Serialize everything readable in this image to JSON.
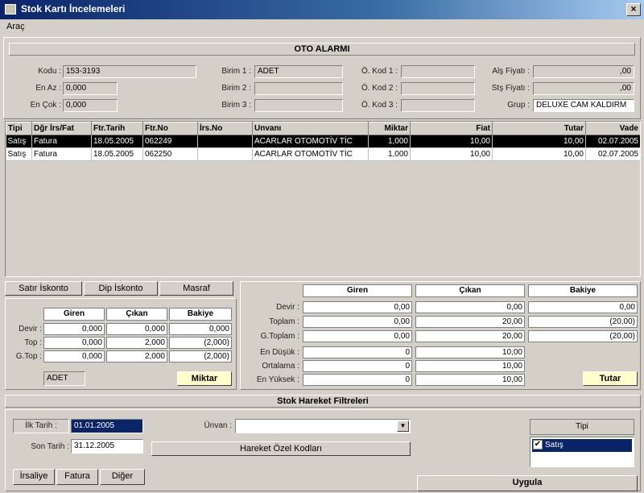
{
  "window": {
    "title": "Stok Kartı İncelemeleri",
    "close": "×"
  },
  "menu": {
    "items": [
      "Araç"
    ]
  },
  "alarm": {
    "title": "OTO ALARMI"
  },
  "info": {
    "kodu_label": "Kodu :",
    "kodu": "153-3193",
    "enaz_label": "En Az :",
    "enaz": "0,000",
    "encok_label": "En Çok :",
    "encok": "0,000",
    "birim1_label": "Birim 1 :",
    "birim1": "ADET",
    "birim2_label": "Birim 2 :",
    "birim2": "",
    "birim3_label": "Birim 3 :",
    "birim3": "",
    "kod1_label": "Ö. Kod 1 :",
    "kod1": "",
    "kod2_label": "Ö. Kod 2 :",
    "kod2": "",
    "kod3_label": "Ö. Kod 3 :",
    "kod3": "",
    "alis_label": "Alş Fiyatı :",
    "alis": ",00",
    "satis_label": "Stş Fiyatı :",
    "satis": ",00",
    "grup_label": "Grup :",
    "grup": "DELUXE CAM KALDIRM"
  },
  "table": {
    "headers": [
      "Tipi",
      "Dğr İrs/Fat",
      "Ftr.Tarih",
      "Ftr.No",
      "İrs.No",
      "Unvanı",
      "Miktar",
      "Fiat",
      "Tutar",
      "Vade"
    ],
    "rows": [
      [
        "Satış",
        "Fatura",
        "18.05.2005",
        "062249",
        "",
        "ACARLAR OTOMOTİV TİC",
        "1,000",
        "10,00",
        "10,00",
        "02.07.2005"
      ],
      [
        "Satış",
        "Fatura",
        "18.05.2005",
        "062250",
        "",
        "ACARLAR OTOMOTİV TİC",
        "1,000",
        "10,00",
        "10,00",
        "02.07.2005"
      ]
    ]
  },
  "tabs": [
    "Satır İskonto",
    "Dip İskonto",
    "Masraf"
  ],
  "small": {
    "headers": [
      "Giren",
      "Çıkan",
      "Bakiye"
    ],
    "rows": [
      {
        "label": "Devir :",
        "values": [
          "0,000",
          "0,000",
          "0,000"
        ]
      },
      {
        "label": "Top :",
        "values": [
          "0,000",
          "2,000",
          "(2,000)"
        ]
      },
      {
        "label": "G.Top :",
        "values": [
          "0,000",
          "2,000",
          "(2,000)"
        ]
      }
    ],
    "unit": "ADET",
    "miktar": "Miktar"
  },
  "big": {
    "headers": [
      "Giren",
      "Çıkan",
      "Bakiye"
    ],
    "rows": [
      {
        "label": "Devir :",
        "values": [
          "0,00",
          "0,00",
          "0,00"
        ]
      },
      {
        "label": "Toplam :",
        "values": [
          "0,00",
          "20,00",
          "(20,00)"
        ]
      },
      {
        "label": "G.Toplam :",
        "values": [
          "0,00",
          "20,00",
          "(20,00)"
        ]
      }
    ],
    "stats": [
      {
        "label": "En Düşük :",
        "values": [
          "0",
          "10,00"
        ]
      },
      {
        "label": "Ortalama :",
        "values": [
          "0",
          "10,00"
        ]
      },
      {
        "label": "En Yüksek :",
        "values": [
          "0",
          "10,00"
        ]
      }
    ],
    "tutar": "Tutar"
  },
  "filters": {
    "title": "Stok Hareket Filtreleri",
    "ilk_label": "İlk Tarih :",
    "ilk": "01.01.2005",
    "son_label": "Son Tarih :",
    "son": "31.12.2005",
    "unvan_label": "Ünvan :",
    "unvan": "",
    "ozel": "Hareket Özel Kodları",
    "buttons": [
      "İrsaliye",
      "Fatura",
      "Diğer"
    ],
    "tipi_title": "Tipi",
    "tipi_items": [
      "Satış"
    ],
    "uygula": "Uygula"
  }
}
